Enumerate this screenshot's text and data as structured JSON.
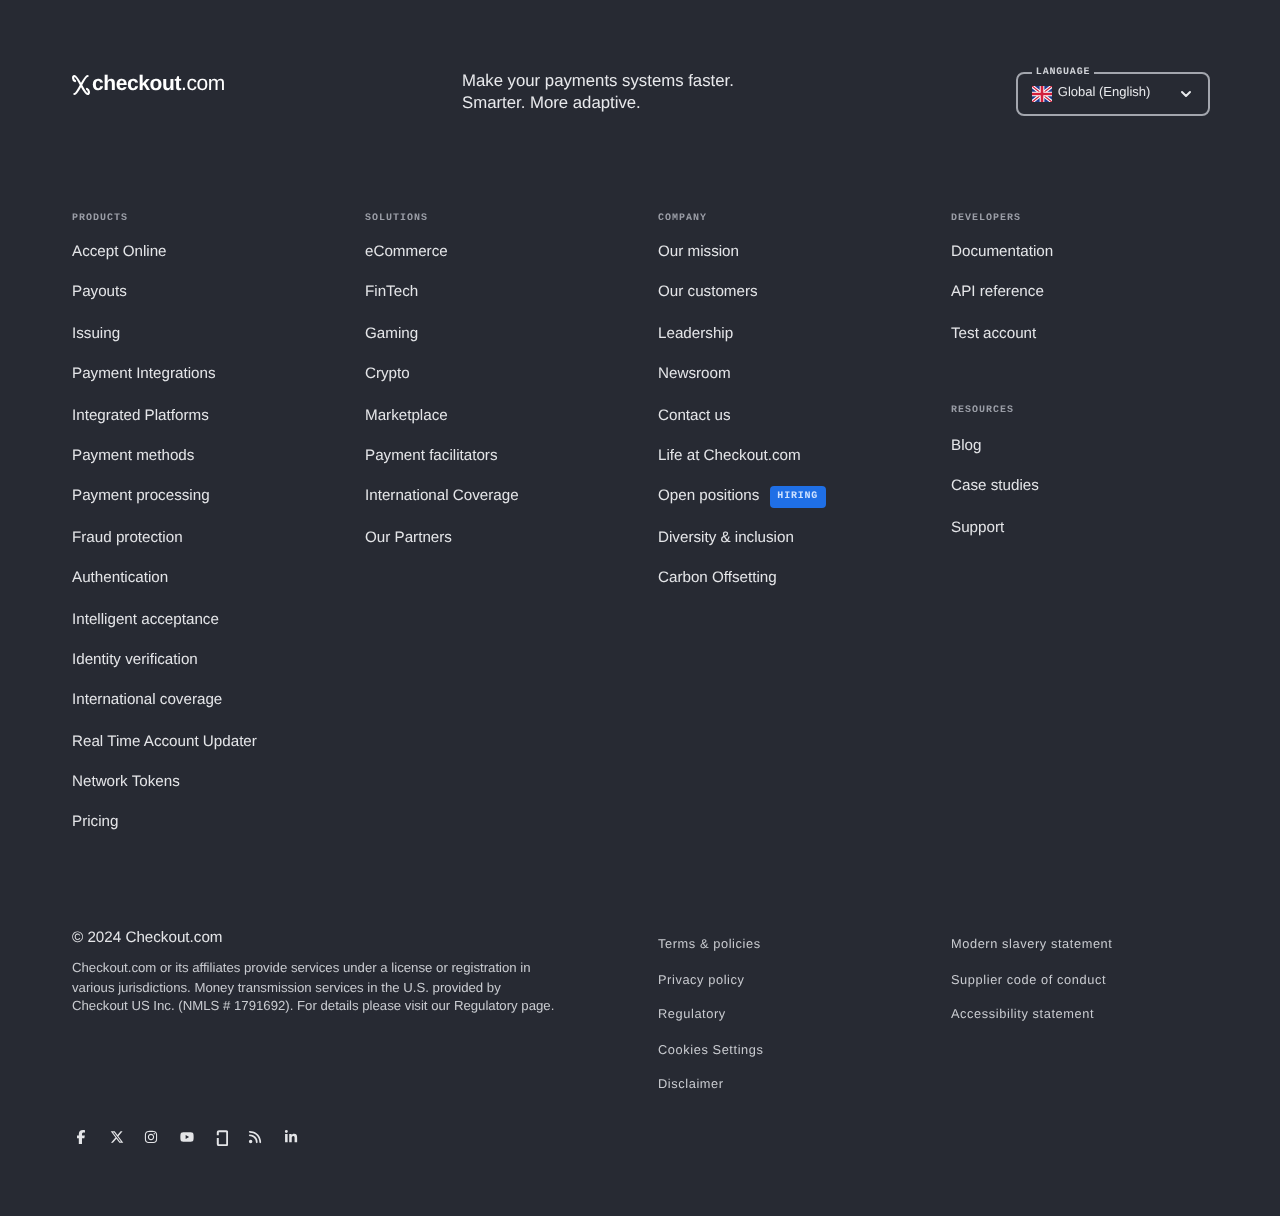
{
  "header": {
    "logo": "**checkout**.com",
    "tagline": [
      "Make your payments systems faster.",
      "Smarter. More adaptive."
    ],
    "language": {
      "label": "LANGUAGE",
      "value": "Global (English)"
    }
  },
  "nav_columns": [
    {
      "sections": [
        {
          "heading": "PRODUCTS",
          "links": [
            {
              "label": "Accept Online"
            },
            {
              "label": "Payouts"
            },
            {
              "label": "Issuing"
            },
            {
              "label": "Payment Integrations"
            },
            {
              "label": "Integrated Platforms"
            },
            {
              "label": "Payment methods"
            },
            {
              "label": "Payment processing"
            },
            {
              "label": "Fraud protection"
            },
            {
              "label": "Authentication"
            },
            {
              "label": "Intelligent acceptance"
            },
            {
              "label": "Identity verification"
            },
            {
              "label": "International coverage"
            },
            {
              "label": "Real Time Account Updater"
            },
            {
              "label": "Network Tokens"
            },
            {
              "label": "Pricing"
            }
          ]
        }
      ]
    },
    {
      "sections": [
        {
          "heading": "SOLUTIONS",
          "links": [
            {
              "label": "eCommerce"
            },
            {
              "label": "FinTech"
            },
            {
              "label": "Gaming"
            },
            {
              "label": "Crypto"
            },
            {
              "label": "Marketplace"
            },
            {
              "label": "Payment facilitators"
            },
            {
              "label": "International Coverage"
            },
            {
              "label": "Our Partners"
            }
          ]
        }
      ]
    },
    {
      "sections": [
        {
          "heading": "COMPANY",
          "links": [
            {
              "label": "Our mission"
            },
            {
              "label": "Our customers"
            },
            {
              "label": "Leadership"
            },
            {
              "label": "Newsroom"
            },
            {
              "label": "Contact us"
            },
            {
              "label": "Life at Checkout.com"
            },
            {
              "label": "Open positions",
              "badge": "HIRING"
            },
            {
              "label": "Diversity & inclusion"
            },
            {
              "label": "Carbon Offsetting"
            }
          ]
        }
      ]
    },
    {
      "sections": [
        {
          "heading": "DEVELOPERS",
          "links": [
            {
              "label": "Documentation"
            },
            {
              "label": "API reference"
            },
            {
              "label": "Test account"
            }
          ]
        },
        {
          "heading": "RESOURCES",
          "links": [
            {
              "label": "Blog"
            },
            {
              "label": "Case studies"
            },
            {
              "label": "Support"
            }
          ]
        }
      ]
    }
  ],
  "footer": {
    "copyright": "© 2024 Checkout.com",
    "disclaimer": [
      "Checkout.com or its affiliates provide services under a license or registration in",
      "various jurisdictions. Money transmission services in the U.S. provided by",
      "Checkout US Inc. (NMLS # 1791692). For details please visit our Regulatory page."
    ],
    "legal_columns": [
      [
        "Terms & policies",
        "Privacy policy",
        "Regulatory",
        "Cookies Settings",
        "Disclaimer"
      ],
      [
        "Modern slavery statement",
        "Supplier code of conduct",
        "Accessibility statement"
      ]
    ]
  }
}
